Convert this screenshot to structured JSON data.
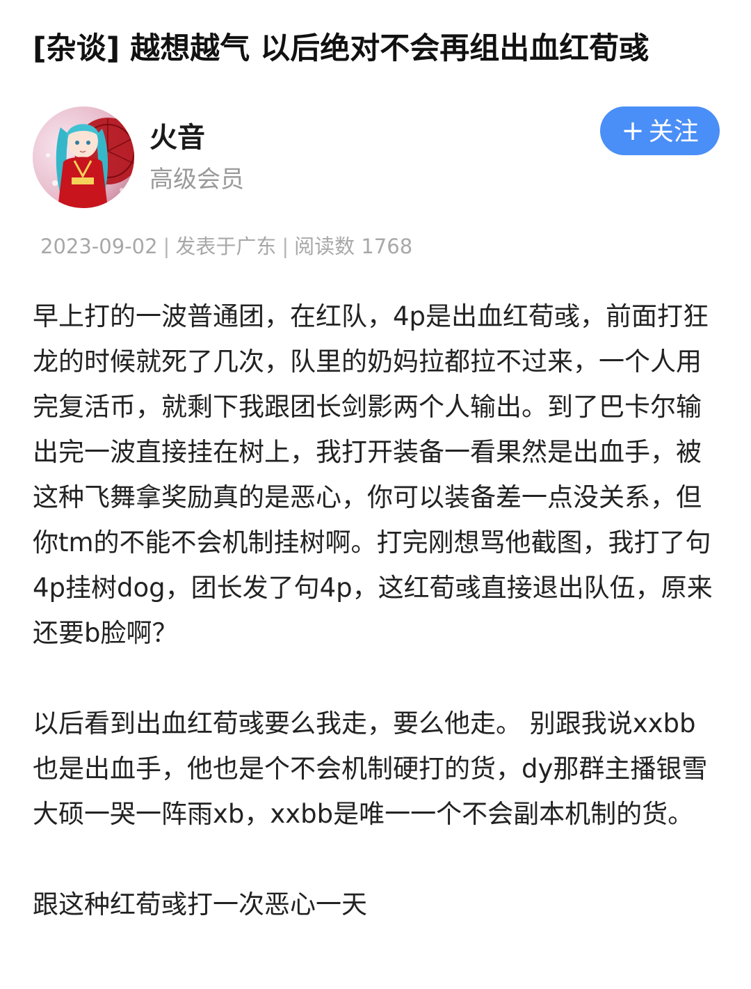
{
  "post": {
    "title": "[杂谈] 越想越气 以后绝对不会再组出血红荀彧"
  },
  "author": {
    "name": "火音",
    "rank": "高级会员",
    "avatar_icon": "avatar-anime-girl"
  },
  "follow_button": {
    "plus": "+",
    "label": "关注"
  },
  "meta": {
    "date": "2023-09-02",
    "location": "发表于广东",
    "reads": "阅读数 1768",
    "separator": "|"
  },
  "content": {
    "paragraphs": [
      "早上打的一波普通团，在红队，4p是出血红荀彧，前面打狂龙的时候就死了几次，队里的奶妈拉都拉不过来，一个人用完复活币，就剩下我跟团长剑影两个人输出。到了巴卡尔输出完一波直接挂在树上，我打开装备一看果然是出血手，被这种飞舞拿奖励真的是恶心，你可以装备差一点没关系，但你tm的不能不会机制挂树啊。打完刚想骂他截图，我打了句4p挂树dog，团长发了句4p，这红荀彧直接退出队伍，原来还要b脸啊？",
      "以后看到出血红荀彧要么我走，要么他走。 别跟我说xxbb也是出血手，他也是个不会机制硬打的货，dy那群主播银雪大硕一哭一阵雨xb，xxbb是唯一一个不会副本机制的货。",
      "跟这种红荀彧打一次恶心一天"
    ]
  },
  "colors": {
    "accent": "#4a8ef7",
    "meta_text": "#a8a8a8",
    "body_text": "#222222"
  }
}
